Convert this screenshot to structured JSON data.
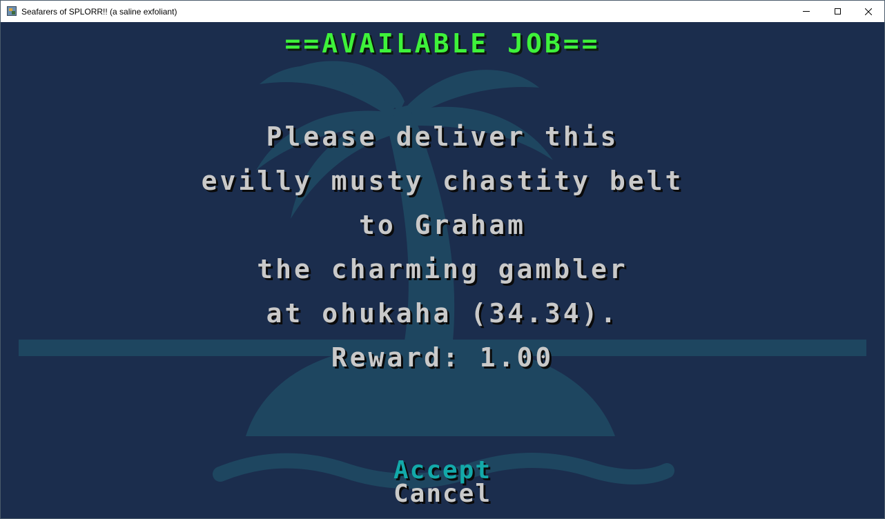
{
  "window": {
    "title": "Seafarers of SPLORR!! (a saline exfoliant)",
    "icon": "app-icon",
    "controls": [
      "minimize-icon",
      "maximize-icon",
      "close-icon"
    ]
  },
  "screen": {
    "heading": "==AVAILABLE JOB==",
    "message_lines": [
      "Please deliver this",
      "evilly musty chastity belt",
      "to Graham",
      "the charming gambler",
      "at ohukaha (34.34).",
      "Reward: 1.00"
    ],
    "menu": [
      {
        "label": "Accept",
        "selected": true
      },
      {
        "label": "Cancel",
        "selected": false
      }
    ]
  },
  "colors": {
    "background": "#1b2d4d",
    "watermark": "#1e4660",
    "heading": "#3ef23a",
    "text": "#c9c9c9",
    "selected": "#13a9a9"
  }
}
